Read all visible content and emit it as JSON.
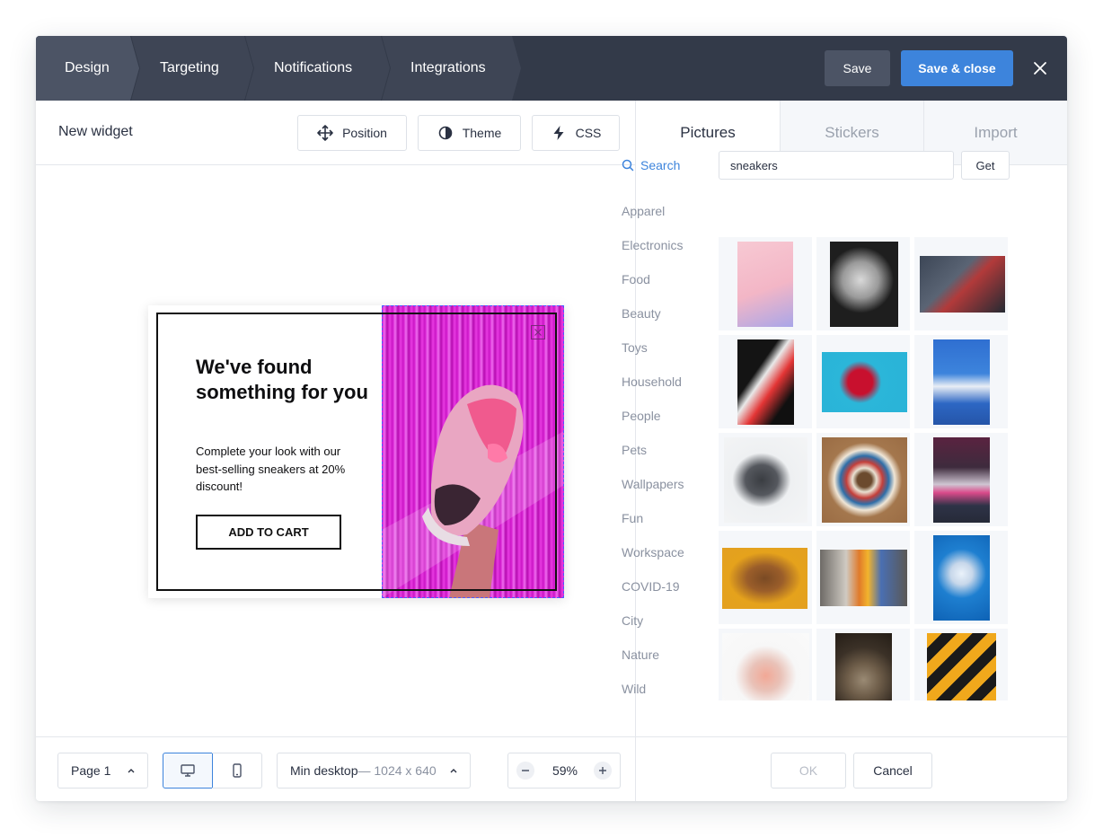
{
  "steps": [
    "Design",
    "Targeting",
    "Notifications",
    "Integrations"
  ],
  "topbar": {
    "save_label": "Save",
    "save_close_label": "Save & close",
    "close_icon": "close-icon"
  },
  "editor": {
    "widget_name": "New widget",
    "tools": {
      "position": "Position",
      "theme": "Theme",
      "css": "CSS"
    },
    "popup": {
      "title": "We've found something for you",
      "text": "Complete your look with our best-selling sneakers at 20% discount!",
      "cta": "ADD TO CART"
    },
    "footer": {
      "page": "Page 1",
      "size_label": "Min desktop",
      "size_dims": "— 1024 x 640",
      "zoom": "59%"
    }
  },
  "panel": {
    "tabs": [
      "Pictures",
      "Stickers",
      "Import"
    ],
    "active_tab": "Pictures",
    "search_label": "Search",
    "search_value": "sneakers",
    "get_label": "Get",
    "categories": [
      "Apparel",
      "Electronics",
      "Food",
      "Beauty",
      "Toys",
      "Household",
      "People",
      "Pets",
      "Wallpapers",
      "Fun",
      "Workspace",
      "COVID-19",
      "City",
      "Nature",
      "Wild"
    ],
    "ok_label": "OK",
    "cancel_label": "Cancel"
  },
  "colors": {
    "topbar": "#333a49",
    "accent": "#3d84dc",
    "muted_text": "#8a91a0",
    "popup_image": "#d012c9"
  }
}
